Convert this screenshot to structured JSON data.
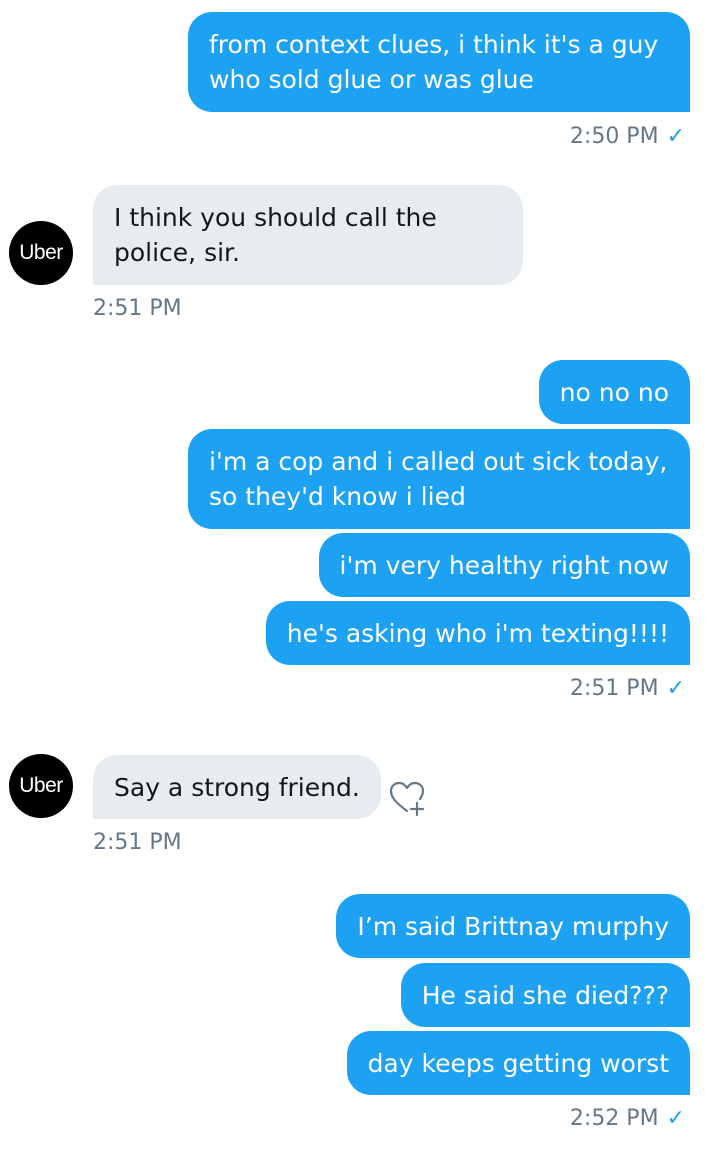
{
  "conversation": {
    "groups": [
      {
        "sender": "me",
        "messages": [
          "from context clues, i think it's a guy who sold glue or was glue"
        ],
        "time": "2:50 PM",
        "read_check": "✓"
      },
      {
        "sender": "Uber",
        "avatar_label": "Uber",
        "messages": [
          "I think you should call the police, sir."
        ],
        "time": "2:51 PM"
      },
      {
        "sender": "me",
        "messages": [
          "no no no",
          "i'm a cop and i called out sick today, so they'd know i lied",
          "i'm very healthy right now",
          "he's asking who i'm texting!!!!"
        ],
        "time": "2:51 PM",
        "read_check": "✓"
      },
      {
        "sender": "Uber",
        "avatar_label": "Uber",
        "messages": [
          "Say a strong friend."
        ],
        "time": "2:51 PM",
        "reaction_icon": "heart-plus-icon"
      },
      {
        "sender": "me",
        "messages": [
          "I’m said Brittnay murphy",
          "He said she died???",
          "day keeps getting worst"
        ],
        "time": "2:52 PM",
        "read_check": "✓"
      }
    ]
  },
  "colors": {
    "outgoing_bubble": "#1da1f2",
    "incoming_bubble": "#e6ecf0",
    "timestamp": "#657786",
    "avatar_bg": "#000000"
  }
}
